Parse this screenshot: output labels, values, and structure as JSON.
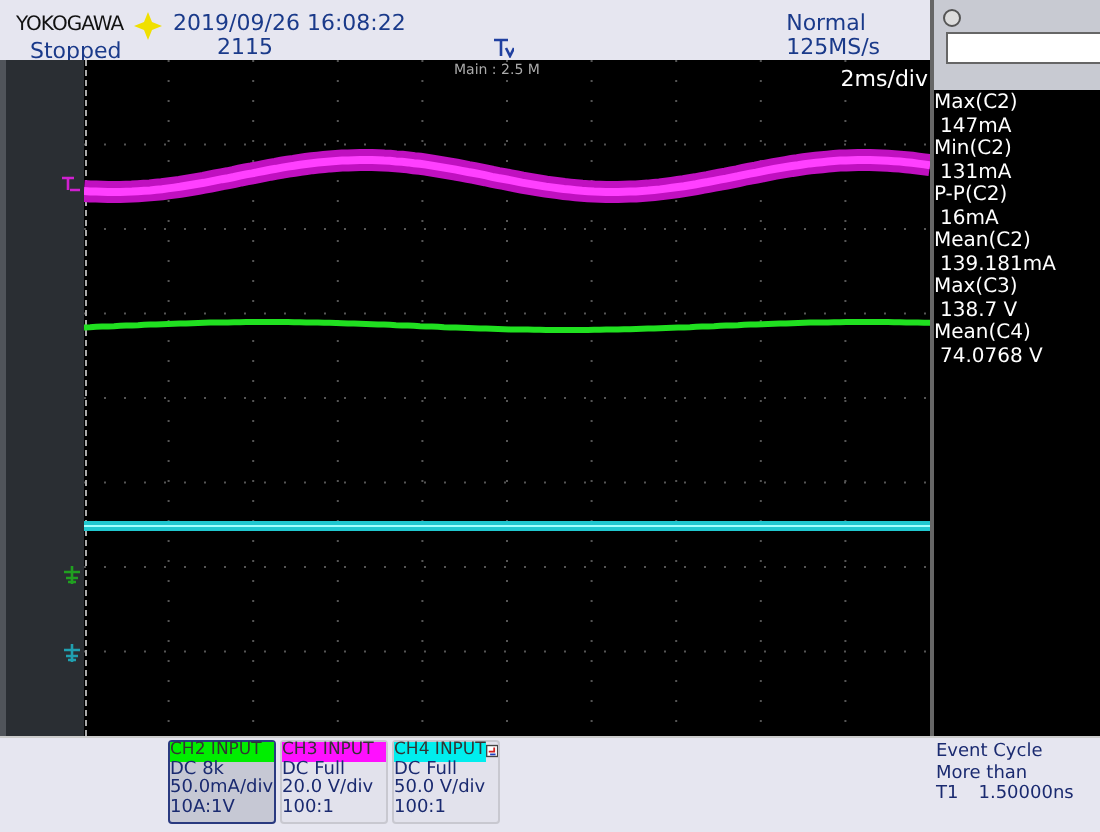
{
  "header": {
    "brand": "YOKOGAWA",
    "datetime": "2019/09/26 16:08:22",
    "status": "Stopped",
    "count": "2115",
    "trigger_mode": "Normal",
    "sample_rate": "125MS/s"
  },
  "display": {
    "memory": "Main : 2.5 M",
    "timebase": "2ms/div"
  },
  "measurements": [
    {
      "label": "Max(C2)",
      "value": "147mA"
    },
    {
      "label": "Min(C2)",
      "value": "131mA"
    },
    {
      "label": "P-P(C2)",
      "value": "16mA"
    },
    {
      "label": "Mean(C2)",
      "value": "139.181mA"
    },
    {
      "label": "Max(C3)",
      "value": "138.7 V"
    },
    {
      "label": "Mean(C4)",
      "value": "74.0768 V"
    }
  ],
  "channels": [
    {
      "name": "CH2 INPUT",
      "color": "#00ee00",
      "selected": true,
      "lines": [
        "DC 8k",
        "50.0mA/div",
        "10A:1V"
      ]
    },
    {
      "name": "CH3 INPUT",
      "color": "#ff10ff",
      "selected": false,
      "lines": [
        "DC Full",
        "20.0 V/div",
        "100:1"
      ]
    },
    {
      "name": "CH4 INPUT",
      "color": "#00eeee",
      "selected": false,
      "lines": [
        "DC Full",
        "50.0 V/div",
        "100:1"
      ]
    }
  ],
  "event": {
    "lines": [
      "Event Cycle",
      "More than"
    ],
    "label": "T1",
    "value": "1.50000ns"
  }
}
